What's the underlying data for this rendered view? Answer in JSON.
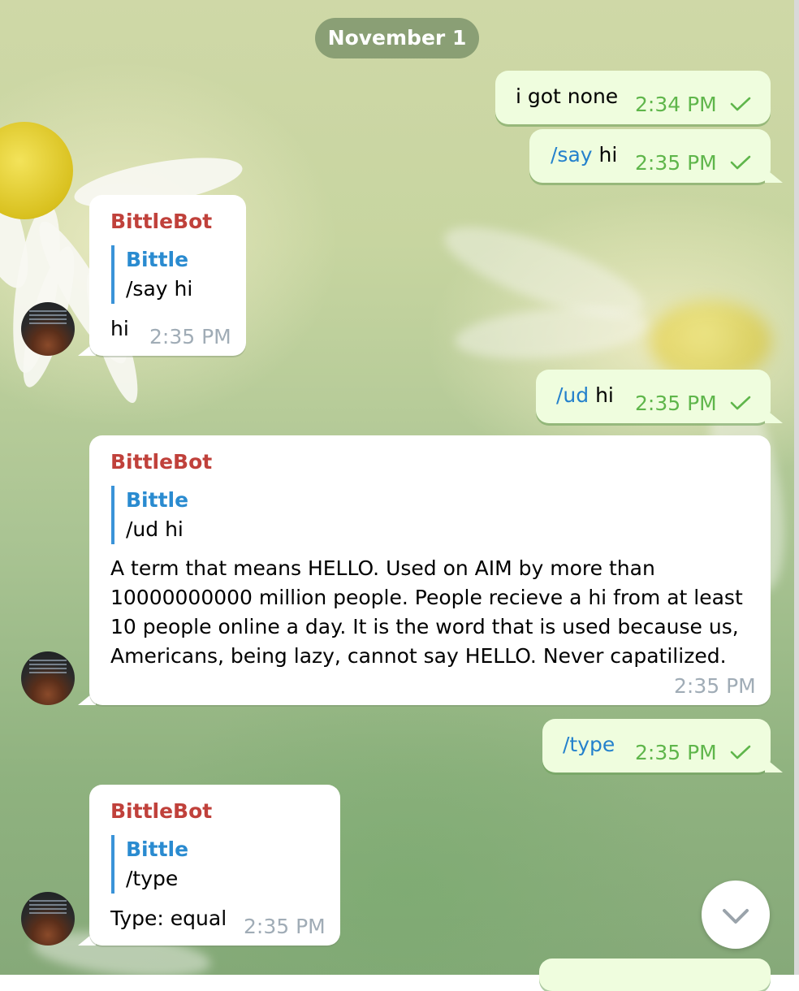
{
  "chat": {
    "date_label": "November 1",
    "messages": [
      {
        "direction": "out",
        "text": "i got none",
        "time": "2:34 PM",
        "read": true
      },
      {
        "direction": "out",
        "command": "/say",
        "text": " hi",
        "time": "2:35 PM",
        "read": true
      },
      {
        "direction": "in",
        "sender": "BittleBot",
        "reply_to": {
          "name": "Bittle",
          "text": "/say hi"
        },
        "text": "hi",
        "time": "2:35 PM"
      },
      {
        "direction": "out",
        "command": "/ud",
        "text": " hi",
        "time": "2:35 PM",
        "read": true
      },
      {
        "direction": "in",
        "sender": "BittleBot",
        "reply_to": {
          "name": "Bittle",
          "text": "/ud hi"
        },
        "text": "A term that means HELLO. Used on AIM by more than 10000000000 million people. People recieve a hi from at least 10 people online a day. It is the word that is used because us, Americans, being lazy, cannot say HELLO. Never capatilized.",
        "time": "2:35 PM"
      },
      {
        "direction": "out",
        "command": "/type",
        "text": "",
        "time": "2:35 PM",
        "read": true
      },
      {
        "direction": "in",
        "sender": "BittleBot",
        "reply_to": {
          "name": "Bittle",
          "text": "/type"
        },
        "text": "Type: equal",
        "time": "2:35 PM"
      }
    ]
  },
  "icons": {
    "read_check": "check-icon",
    "scroll_down": "chevron-down-icon",
    "avatar": "avatar-image"
  },
  "colors": {
    "outgoing_bubble": "#effdde",
    "incoming_bubble": "#ffffff",
    "sender_name": "#c0413b",
    "reply_name": "#2a8bd0",
    "command_link": "#2481cc",
    "outgoing_time": "#5fb64b",
    "incoming_time": "#a0acb6"
  }
}
